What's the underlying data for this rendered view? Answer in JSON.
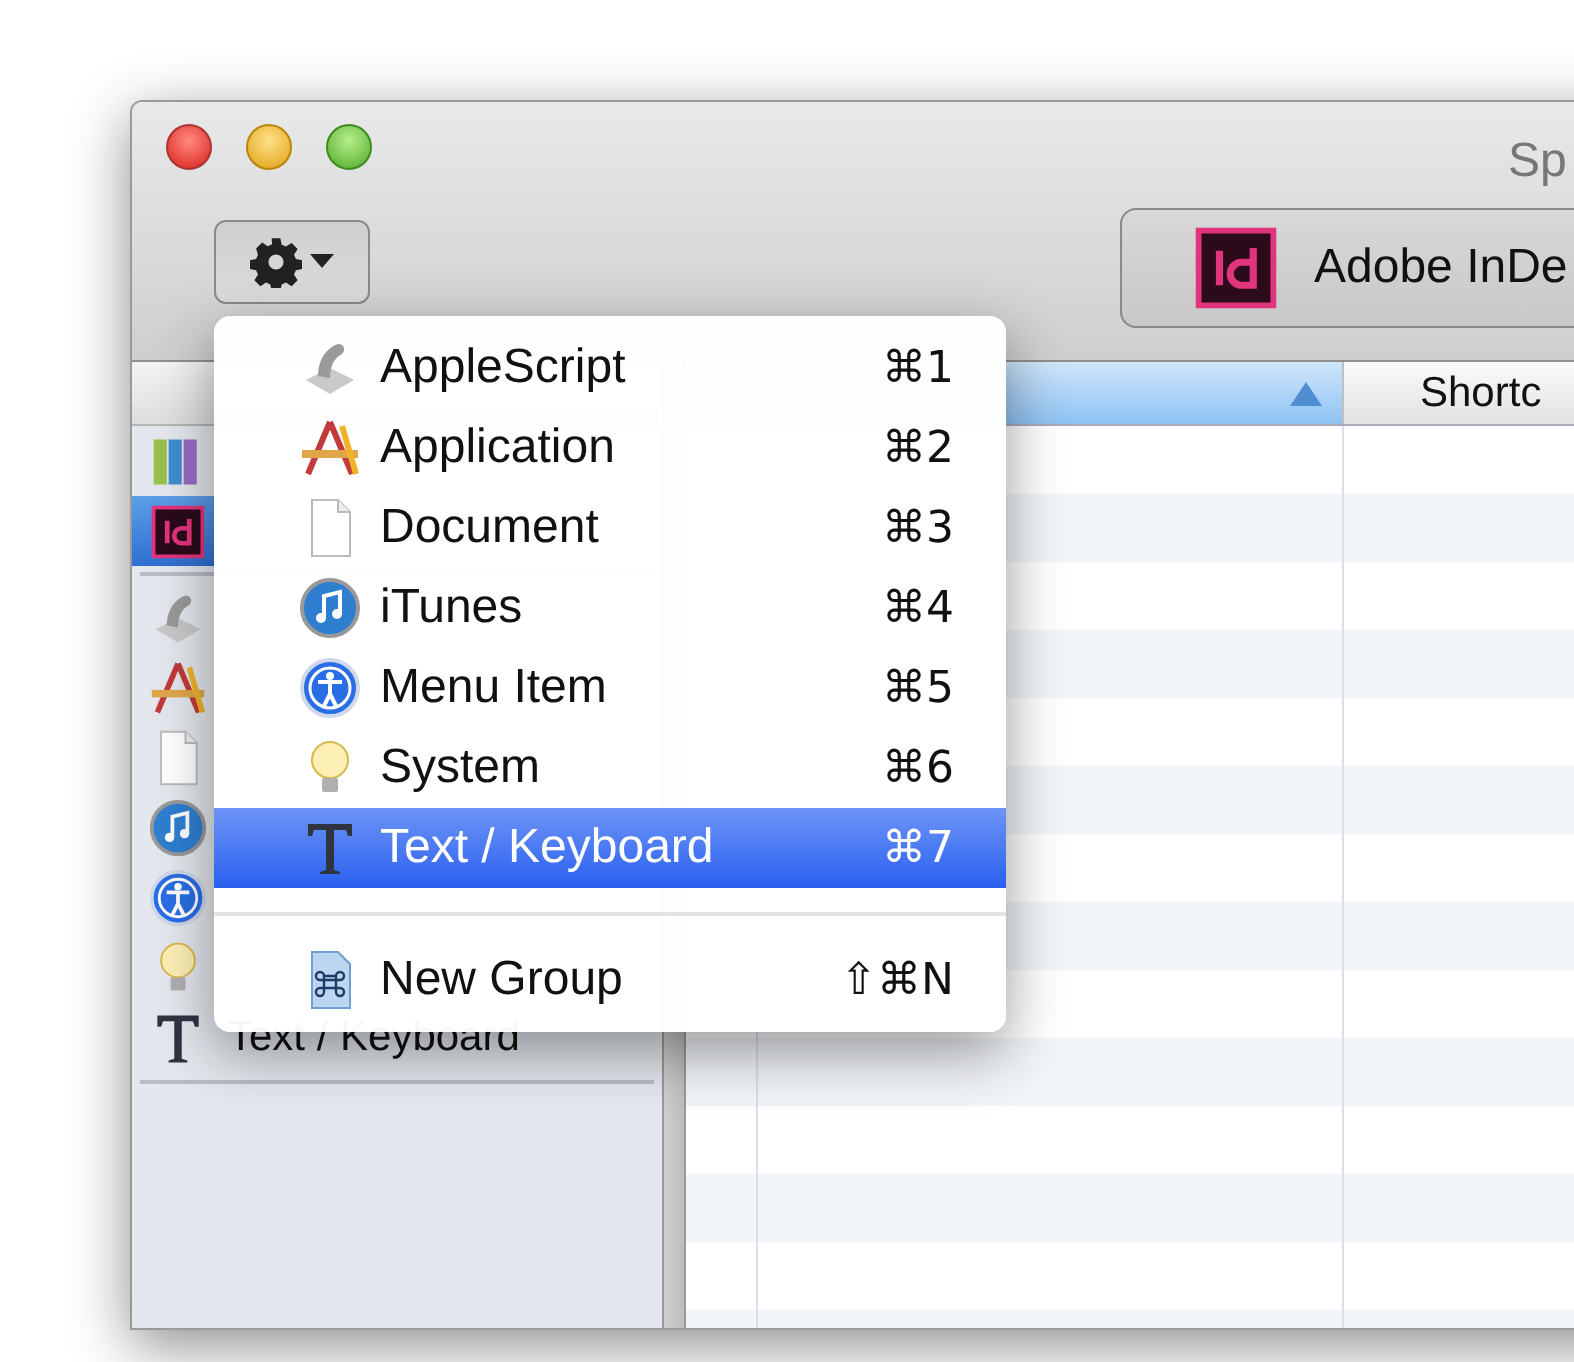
{
  "window": {
    "title": "Sp"
  },
  "toolbar": {
    "action_button": {
      "expanded": true
    },
    "app_selector": {
      "label": "Adobe InDe"
    }
  },
  "sidebar": {
    "items": [
      {
        "kind": "library",
        "selected": false
      },
      {
        "kind": "indesign",
        "selected": true
      },
      {
        "kind": "applescript",
        "selected": false
      },
      {
        "kind": "application",
        "selected": false
      },
      {
        "kind": "document",
        "selected": false
      },
      {
        "kind": "itunes",
        "selected": false
      },
      {
        "kind": "menu-item",
        "selected": false
      },
      {
        "kind": "system",
        "selected": false
      },
      {
        "kind": "text",
        "selected": false,
        "label": "Text / Keyboard"
      }
    ]
  },
  "table": {
    "columns": [
      {
        "selected": true,
        "sorted": true
      },
      {
        "label": "Shortc",
        "selected": false
      }
    ]
  },
  "menu": {
    "sections": [
      [
        {
          "kind": "applescript",
          "label": "AppleScript",
          "shortcut": "⌘1",
          "selected": false
        },
        {
          "kind": "application",
          "label": "Application",
          "shortcut": "⌘2",
          "selected": false
        },
        {
          "kind": "document",
          "label": "Document",
          "shortcut": "⌘3",
          "selected": false
        },
        {
          "kind": "itunes",
          "label": "iTunes",
          "shortcut": "⌘4",
          "selected": false
        },
        {
          "kind": "menu-item",
          "label": "Menu Item",
          "shortcut": "⌘5",
          "selected": false
        },
        {
          "kind": "system",
          "label": "System",
          "shortcut": "⌘6",
          "selected": false
        },
        {
          "kind": "text",
          "label": "Text / Keyboard",
          "shortcut": "⌘7",
          "selected": true
        }
      ],
      [
        {
          "kind": "group",
          "label": "New Group",
          "shortcut": "⇧⌘N",
          "selected": false
        }
      ]
    ]
  }
}
